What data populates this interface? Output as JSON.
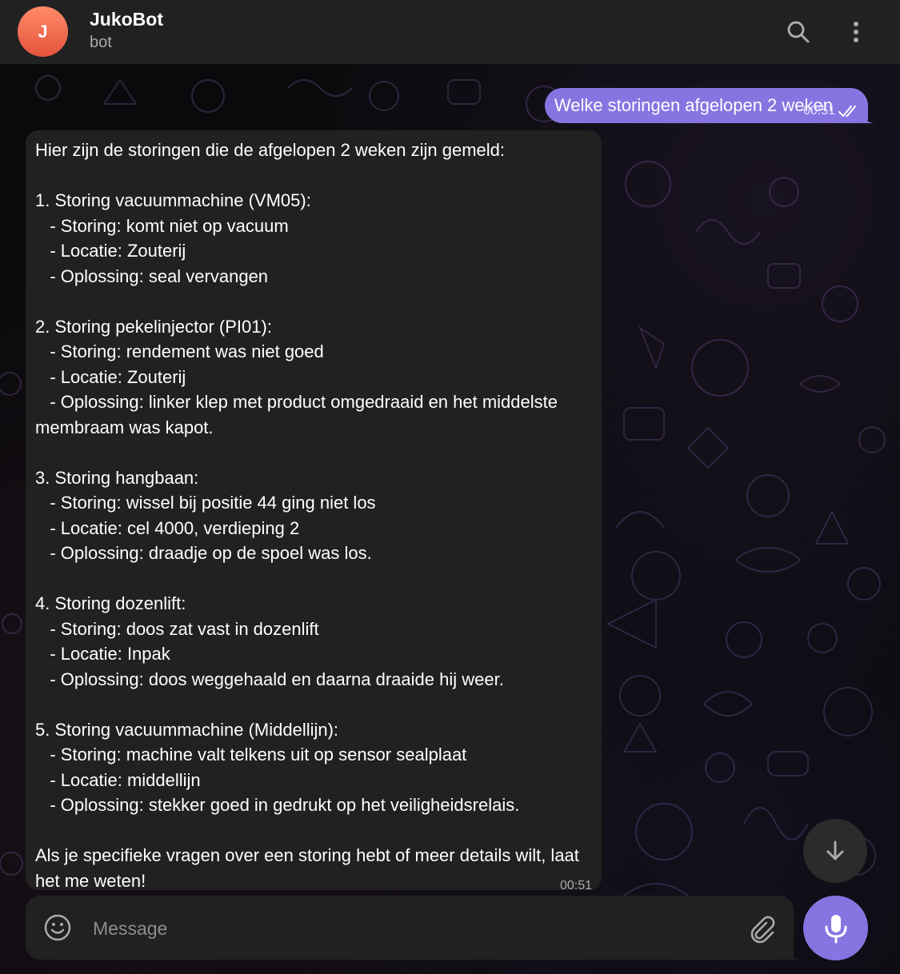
{
  "header": {
    "avatar_letter": "J",
    "name": "JukoBot",
    "status": "bot",
    "avatar_color": "#e4543c"
  },
  "messages": {
    "outgoing": {
      "text": "Welke storingen afgelopen 2 weken",
      "time": "00:51",
      "read_status": "double-check-icon"
    },
    "incoming": {
      "text": "Hier zijn de storingen die de afgelopen 2 weken zijn gemeld:\n\n1. Storing vacuummachine (VM05):\n   - Storing: komt niet op vacuum\n   - Locatie: Zouterij\n   - Oplossing: seal vervangen\n\n2. Storing pekelinjector (PI01):\n   - Storing: rendement was niet goed\n   - Locatie: Zouterij\n   - Oplossing: linker klep met product omgedraaid en het middelste membraam was kapot.\n\n3. Storing hangbaan:\n   - Storing: wissel bij positie 44 ging niet los\n   - Locatie: cel 4000, verdieping 2\n   - Oplossing: draadje op de spoel was los.\n\n4. Storing dozenlift:\n   - Storing: doos zat vast in dozenlift\n   - Locatie: Inpak\n   - Oplossing: doos weggehaald en daarna draaide hij weer.\n\n5. Storing vacuummachine (Middellijn):\n   - Storing: machine valt telkens uit op sensor sealplaat\n   - Locatie: middellijn\n   - Oplossing: stekker goed in gedrukt op het veiligheidsrelais.\n\nAls je specifieke vragen over een storing hebt of meer details wilt, laat het me weten!",
      "time": "00:51"
    }
  },
  "composer": {
    "placeholder": "Message"
  },
  "icons": {
    "search": "search-icon",
    "more": "more-vertical-icon",
    "scroll": "arrow-down-icon",
    "emoji": "emoji-icon",
    "attach": "paperclip-icon",
    "mic": "microphone-icon"
  },
  "colors": {
    "accent": "#8774e1",
    "bubble": "#212121",
    "header": "#212121"
  }
}
